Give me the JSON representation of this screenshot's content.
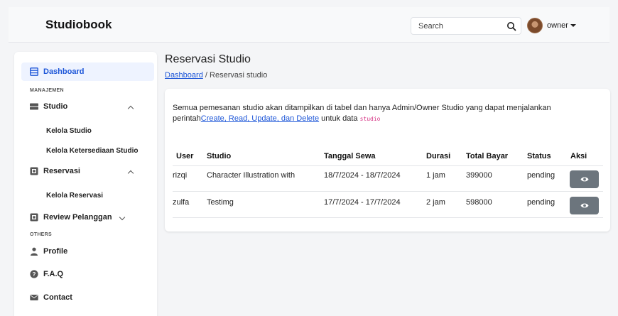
{
  "navbar": {
    "brand": "Studiobook",
    "search_placeholder": "Search",
    "user_name": "owner"
  },
  "sidebar": {
    "dashboard": "Dashboard",
    "section_manajemen": "MANAJEMEN",
    "studio": "Studio",
    "studio_sub": [
      "Kelola Studio",
      "Kelola Ketersediaan Studio"
    ],
    "reservasi": "Reservasi",
    "reservasi_sub": [
      "Kelola Reservasi"
    ],
    "review": "Review Pelanggan",
    "section_others": "OTHERS",
    "profile": "Profile",
    "faq": "F.A.Q",
    "contact": "Contact"
  },
  "main": {
    "title": "Reservasi Studio",
    "breadcrumb_link": "Dashboard",
    "breadcrumb_sep": "/",
    "breadcrumb_current": "Reservasi studio",
    "desc_prefix": "Semua pemesanan studio akan ditampilkan di tabel dan hanya Admin/Owner Studio yang dapat menjalankan perintah",
    "desc_link": "Create, Read, Update, dan Delete",
    "desc_mid": " untuk data ",
    "desc_code": "studio"
  },
  "table": {
    "columns": [
      "User",
      "Studio",
      "Tanggal Sewa",
      "Durasi",
      "Total Bayar",
      "Status",
      "Aksi"
    ],
    "rows": [
      {
        "user": "rizqi",
        "studio": "Character Illustration with",
        "tanggal": "18/7/2024 - 18/7/2024",
        "durasi": "1 jam",
        "total": "399000",
        "status": "pending"
      },
      {
        "user": "zulfa",
        "studio": "Testimg",
        "tanggal": "17/7/2024 - 17/7/2024",
        "durasi": "2 jam",
        "total": "598000",
        "status": "pending"
      }
    ]
  },
  "colors": {
    "accent": "#1d56d8",
    "action_button": "#6c757d",
    "code": "#d63384"
  },
  "icons": [
    "search-icon",
    "avatar",
    "caret-down-icon",
    "table-icon",
    "server-icon",
    "calendar-icon",
    "person-icon",
    "question-icon",
    "envelope-icon",
    "chevron-up-icon",
    "chevron-down-icon",
    "eye-icon"
  ]
}
